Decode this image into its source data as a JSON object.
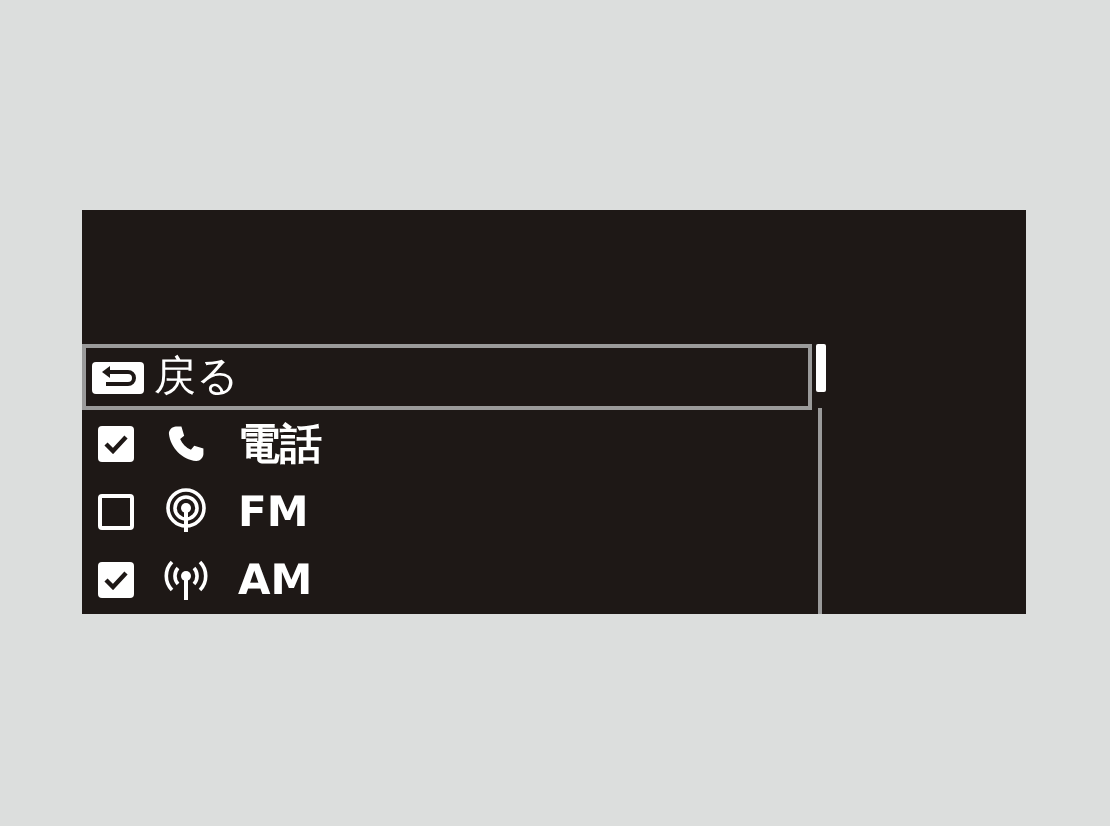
{
  "menu": {
    "back": {
      "label": "戻る",
      "selected": true
    },
    "items": [
      {
        "kind": "phone",
        "label": "電話",
        "checked": true
      },
      {
        "kind": "fm",
        "label": "FM",
        "checked": false
      },
      {
        "kind": "am",
        "label": "AM",
        "checked": true
      }
    ]
  }
}
